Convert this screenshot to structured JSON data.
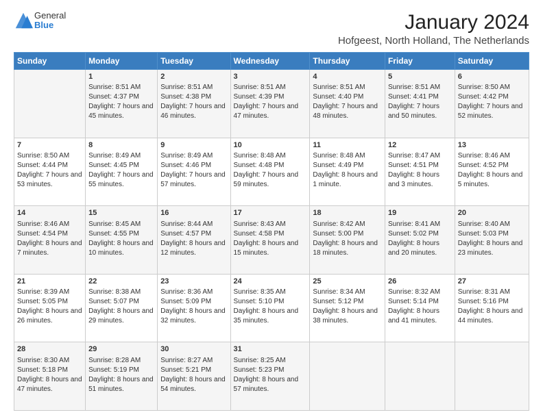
{
  "logo": {
    "general": "General",
    "blue": "Blue"
  },
  "title": "January 2024",
  "subtitle": "Hofgeest, North Holland, The Netherlands",
  "headers": [
    "Sunday",
    "Monday",
    "Tuesday",
    "Wednesday",
    "Thursday",
    "Friday",
    "Saturday"
  ],
  "weeks": [
    [
      {
        "day": "",
        "sunrise": "",
        "sunset": "",
        "daylight": ""
      },
      {
        "day": "1",
        "sunrise": "Sunrise: 8:51 AM",
        "sunset": "Sunset: 4:37 PM",
        "daylight": "Daylight: 7 hours and 45 minutes."
      },
      {
        "day": "2",
        "sunrise": "Sunrise: 8:51 AM",
        "sunset": "Sunset: 4:38 PM",
        "daylight": "Daylight: 7 hours and 46 minutes."
      },
      {
        "day": "3",
        "sunrise": "Sunrise: 8:51 AM",
        "sunset": "Sunset: 4:39 PM",
        "daylight": "Daylight: 7 hours and 47 minutes."
      },
      {
        "day": "4",
        "sunrise": "Sunrise: 8:51 AM",
        "sunset": "Sunset: 4:40 PM",
        "daylight": "Daylight: 7 hours and 48 minutes."
      },
      {
        "day": "5",
        "sunrise": "Sunrise: 8:51 AM",
        "sunset": "Sunset: 4:41 PM",
        "daylight": "Daylight: 7 hours and 50 minutes."
      },
      {
        "day": "6",
        "sunrise": "Sunrise: 8:50 AM",
        "sunset": "Sunset: 4:42 PM",
        "daylight": "Daylight: 7 hours and 52 minutes."
      }
    ],
    [
      {
        "day": "7",
        "sunrise": "Sunrise: 8:50 AM",
        "sunset": "Sunset: 4:44 PM",
        "daylight": "Daylight: 7 hours and 53 minutes."
      },
      {
        "day": "8",
        "sunrise": "Sunrise: 8:49 AM",
        "sunset": "Sunset: 4:45 PM",
        "daylight": "Daylight: 7 hours and 55 minutes."
      },
      {
        "day": "9",
        "sunrise": "Sunrise: 8:49 AM",
        "sunset": "Sunset: 4:46 PM",
        "daylight": "Daylight: 7 hours and 57 minutes."
      },
      {
        "day": "10",
        "sunrise": "Sunrise: 8:48 AM",
        "sunset": "Sunset: 4:48 PM",
        "daylight": "Daylight: 7 hours and 59 minutes."
      },
      {
        "day": "11",
        "sunrise": "Sunrise: 8:48 AM",
        "sunset": "Sunset: 4:49 PM",
        "daylight": "Daylight: 8 hours and 1 minute."
      },
      {
        "day": "12",
        "sunrise": "Sunrise: 8:47 AM",
        "sunset": "Sunset: 4:51 PM",
        "daylight": "Daylight: 8 hours and 3 minutes."
      },
      {
        "day": "13",
        "sunrise": "Sunrise: 8:46 AM",
        "sunset": "Sunset: 4:52 PM",
        "daylight": "Daylight: 8 hours and 5 minutes."
      }
    ],
    [
      {
        "day": "14",
        "sunrise": "Sunrise: 8:46 AM",
        "sunset": "Sunset: 4:54 PM",
        "daylight": "Daylight: 8 hours and 7 minutes."
      },
      {
        "day": "15",
        "sunrise": "Sunrise: 8:45 AM",
        "sunset": "Sunset: 4:55 PM",
        "daylight": "Daylight: 8 hours and 10 minutes."
      },
      {
        "day": "16",
        "sunrise": "Sunrise: 8:44 AM",
        "sunset": "Sunset: 4:57 PM",
        "daylight": "Daylight: 8 hours and 12 minutes."
      },
      {
        "day": "17",
        "sunrise": "Sunrise: 8:43 AM",
        "sunset": "Sunset: 4:58 PM",
        "daylight": "Daylight: 8 hours and 15 minutes."
      },
      {
        "day": "18",
        "sunrise": "Sunrise: 8:42 AM",
        "sunset": "Sunset: 5:00 PM",
        "daylight": "Daylight: 8 hours and 18 minutes."
      },
      {
        "day": "19",
        "sunrise": "Sunrise: 8:41 AM",
        "sunset": "Sunset: 5:02 PM",
        "daylight": "Daylight: 8 hours and 20 minutes."
      },
      {
        "day": "20",
        "sunrise": "Sunrise: 8:40 AM",
        "sunset": "Sunset: 5:03 PM",
        "daylight": "Daylight: 8 hours and 23 minutes."
      }
    ],
    [
      {
        "day": "21",
        "sunrise": "Sunrise: 8:39 AM",
        "sunset": "Sunset: 5:05 PM",
        "daylight": "Daylight: 8 hours and 26 minutes."
      },
      {
        "day": "22",
        "sunrise": "Sunrise: 8:38 AM",
        "sunset": "Sunset: 5:07 PM",
        "daylight": "Daylight: 8 hours and 29 minutes."
      },
      {
        "day": "23",
        "sunrise": "Sunrise: 8:36 AM",
        "sunset": "Sunset: 5:09 PM",
        "daylight": "Daylight: 8 hours and 32 minutes."
      },
      {
        "day": "24",
        "sunrise": "Sunrise: 8:35 AM",
        "sunset": "Sunset: 5:10 PM",
        "daylight": "Daylight: 8 hours and 35 minutes."
      },
      {
        "day": "25",
        "sunrise": "Sunrise: 8:34 AM",
        "sunset": "Sunset: 5:12 PM",
        "daylight": "Daylight: 8 hours and 38 minutes."
      },
      {
        "day": "26",
        "sunrise": "Sunrise: 8:32 AM",
        "sunset": "Sunset: 5:14 PM",
        "daylight": "Daylight: 8 hours and 41 minutes."
      },
      {
        "day": "27",
        "sunrise": "Sunrise: 8:31 AM",
        "sunset": "Sunset: 5:16 PM",
        "daylight": "Daylight: 8 hours and 44 minutes."
      }
    ],
    [
      {
        "day": "28",
        "sunrise": "Sunrise: 8:30 AM",
        "sunset": "Sunset: 5:18 PM",
        "daylight": "Daylight: 8 hours and 47 minutes."
      },
      {
        "day": "29",
        "sunrise": "Sunrise: 8:28 AM",
        "sunset": "Sunset: 5:19 PM",
        "daylight": "Daylight: 8 hours and 51 minutes."
      },
      {
        "day": "30",
        "sunrise": "Sunrise: 8:27 AM",
        "sunset": "Sunset: 5:21 PM",
        "daylight": "Daylight: 8 hours and 54 minutes."
      },
      {
        "day": "31",
        "sunrise": "Sunrise: 8:25 AM",
        "sunset": "Sunset: 5:23 PM",
        "daylight": "Daylight: 8 hours and 57 minutes."
      },
      {
        "day": "",
        "sunrise": "",
        "sunset": "",
        "daylight": ""
      },
      {
        "day": "",
        "sunrise": "",
        "sunset": "",
        "daylight": ""
      },
      {
        "day": "",
        "sunrise": "",
        "sunset": "",
        "daylight": ""
      }
    ]
  ]
}
